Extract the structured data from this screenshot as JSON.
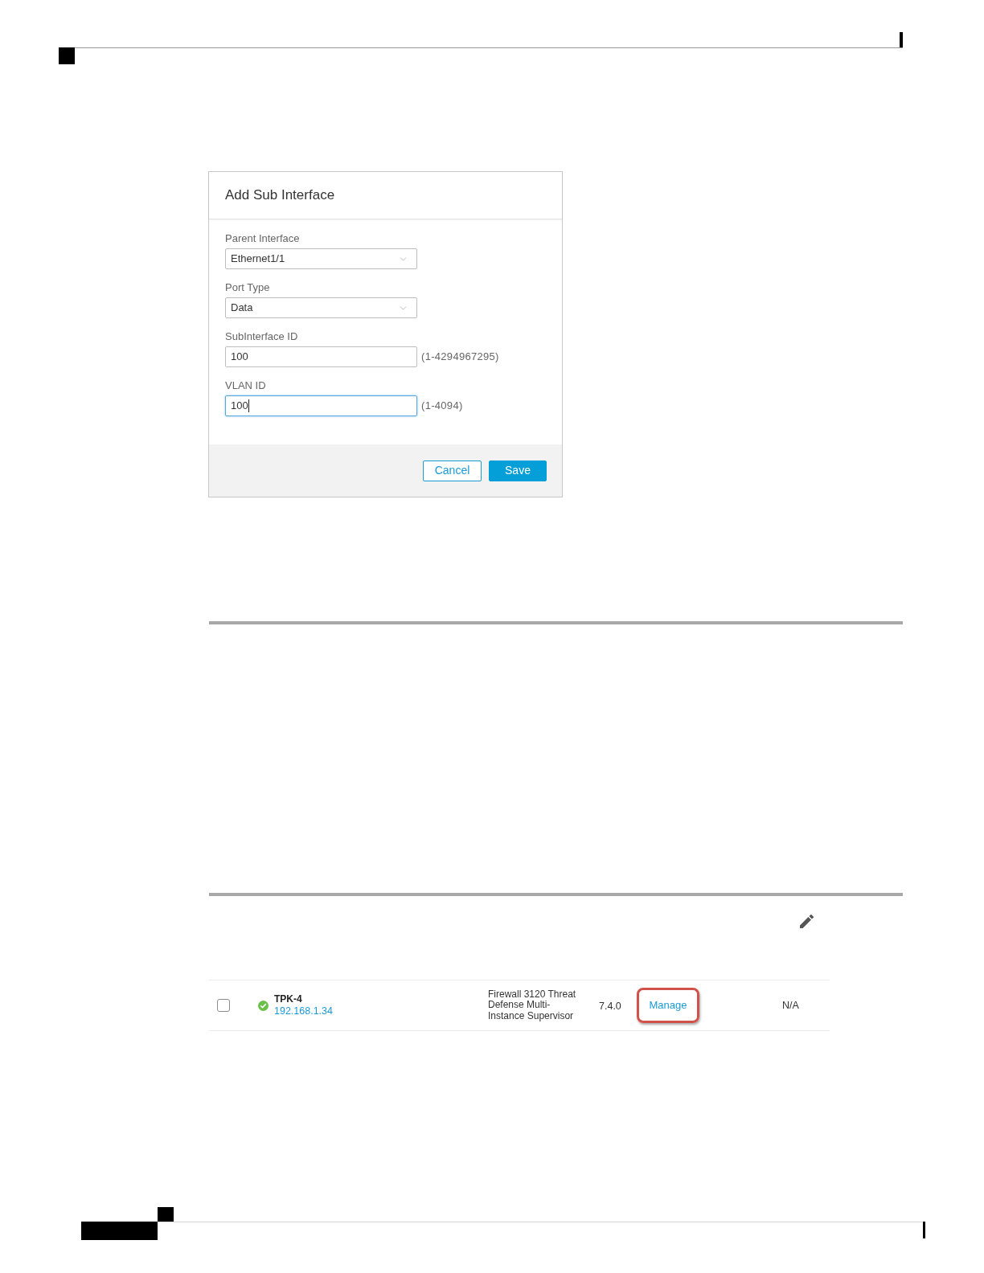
{
  "dialog": {
    "title": "Add Sub Interface",
    "fields": [
      {
        "kind": "select",
        "label": "Parent Interface",
        "value": "Ethernet1/1"
      },
      {
        "kind": "select",
        "label": "Port Type",
        "value": "Data"
      },
      {
        "kind": "text",
        "label": "SubInterface ID",
        "value": "100",
        "hint": "(1-4294967295)",
        "focused": false
      },
      {
        "kind": "text",
        "label": "VLAN ID",
        "value": "100",
        "hint": "(1-4094)",
        "focused": true
      }
    ],
    "buttons": [
      {
        "kind": "secondary",
        "label": "Cancel"
      },
      {
        "kind": "primary",
        "label": "Save"
      }
    ]
  },
  "device_row": {
    "checked": false,
    "healthy": true,
    "name": "TPK-4",
    "address": "192.168.1.34",
    "model": "Firewall 3120 Threat Defense Multi-Instance Supervisor",
    "version": "7.4.0",
    "action": {
      "label": "Manage",
      "highlighted": true
    },
    "column_6": "N/A"
  }
}
